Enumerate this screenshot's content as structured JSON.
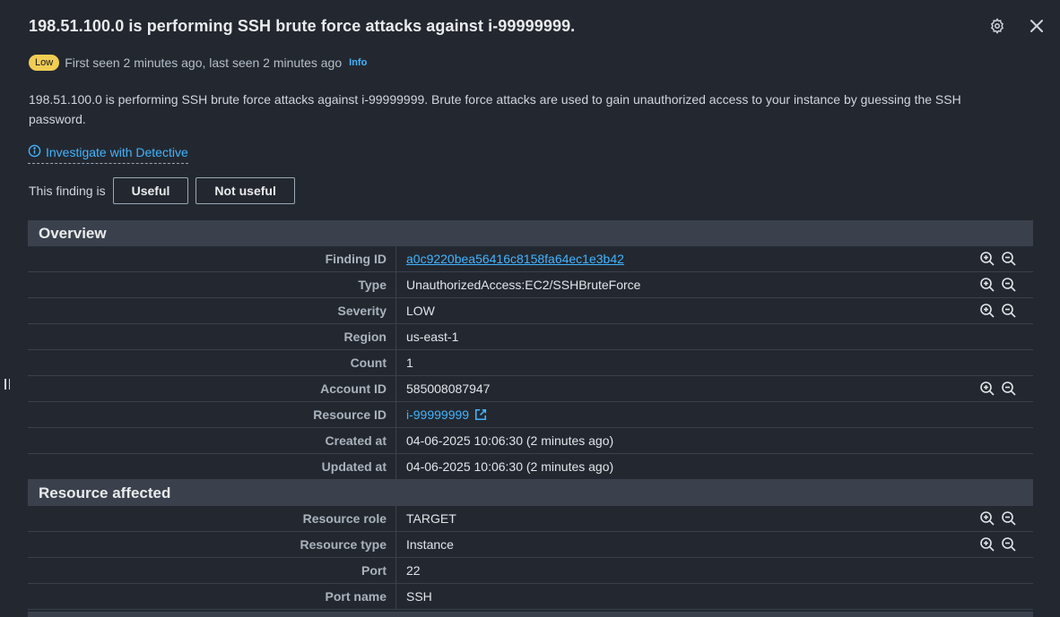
{
  "header": {
    "title": "198.51.100.0 is performing SSH brute force attacks against i-99999999."
  },
  "meta": {
    "severity_badge": "Low",
    "seen_text": "First seen 2 minutes ago, last seen 2 minutes ago",
    "info_label": "Info"
  },
  "description": "198.51.100.0 is performing SSH brute force attacks against i-99999999. Brute force attacks are used to gain unauthorized access to your instance by guessing the SSH password.",
  "investigate_label": "Investigate with Detective",
  "feedback": {
    "prompt": "This finding is",
    "useful_label": "Useful",
    "not_useful_label": "Not useful"
  },
  "overview": {
    "title": "Overview",
    "rows": [
      {
        "label": "Finding ID",
        "value": "a0c9220bea56416c8158fa64ec1e3b42"
      },
      {
        "label": "Type",
        "value": "UnauthorizedAccess:EC2/SSHBruteForce"
      },
      {
        "label": "Severity",
        "value": "LOW"
      },
      {
        "label": "Region",
        "value": "us-east-1"
      },
      {
        "label": "Count",
        "value": "1"
      },
      {
        "label": "Account ID",
        "value": "585008087947"
      },
      {
        "label": "Resource ID",
        "value": "i-99999999"
      },
      {
        "label": "Created at",
        "value": "04-06-2025 10:06:30 (2 minutes ago)"
      },
      {
        "label": "Updated at",
        "value": "04-06-2025 10:06:30 (2 minutes ago)"
      }
    ]
  },
  "resource_affected": {
    "title": "Resource affected",
    "rows": [
      {
        "label": "Resource role",
        "value": "TARGET"
      },
      {
        "label": "Resource type",
        "value": "Instance"
      },
      {
        "label": "Port",
        "value": "22"
      },
      {
        "label": "Port name",
        "value": "SSH"
      }
    ]
  },
  "colors": {
    "background": "#232830",
    "section_header": "#3a414c",
    "link": "#42b4ff",
    "badge_low": "#f2cd54"
  }
}
